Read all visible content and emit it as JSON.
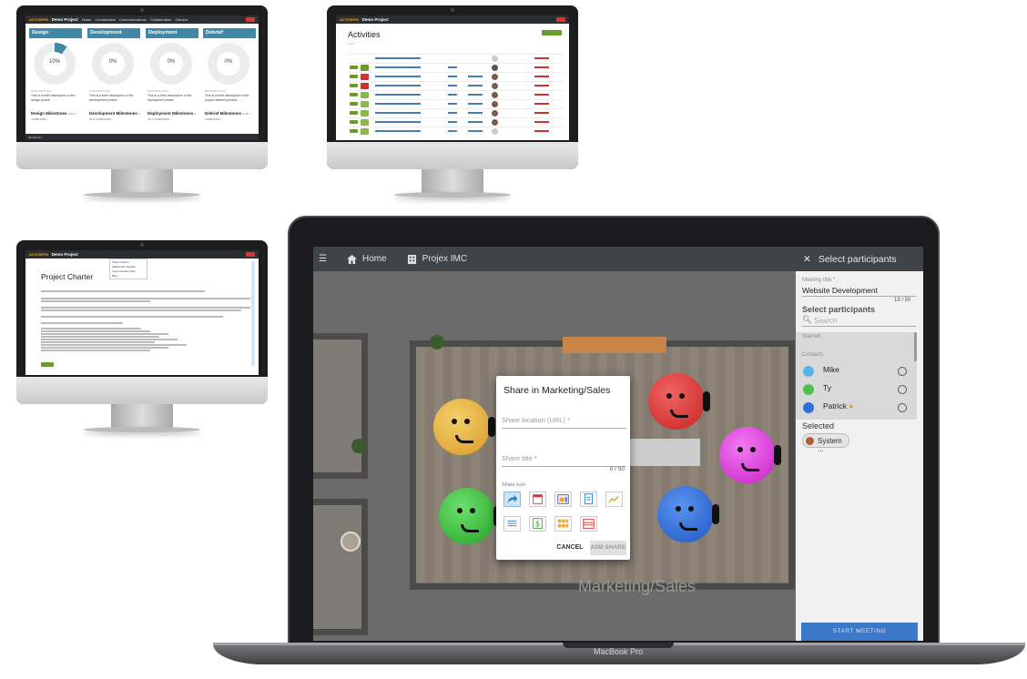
{
  "screen_a": {
    "logo": "ACTIVEPM",
    "project": "Demo Project",
    "nav": [
      "Home",
      "Coordination",
      "Communications",
      "Collaboration",
      "Owners"
    ],
    "phases": [
      {
        "title": "Design",
        "percent": "10%",
        "desc_label": "DESCRIPTION",
        "desc": "This is a brief description of the design phase.",
        "milestones": "Design Milestones",
        "count": "0 OF 4 COMPLETED"
      },
      {
        "title": "Development",
        "percent": "0%",
        "desc_label": "DESCRIPTION",
        "desc": "This is a brief description of the development phase.",
        "milestones": "Development Milestones",
        "count": "0 OF 2 COMPLETED"
      },
      {
        "title": "Deployment",
        "percent": "0%",
        "desc_label": "DESCRIPTION",
        "desc": "This is a brief description of the deployment phase.",
        "milestones": "Deployment Milestones",
        "count": "0 OF 2 COMPLETED"
      },
      {
        "title": "Debrief",
        "percent": "0%",
        "desc_label": "DESCRIPTION",
        "desc": "This is a brief description of the project debrief process.",
        "milestones": "Debrief Milestones",
        "count": "0 OF 1 COMPLETED"
      }
    ],
    "progress_fraction": [
      0.1,
      0,
      0,
      0
    ],
    "footer": "WordPress"
  },
  "screen_b": {
    "logo": "ACTIVEPM",
    "project": "Demo Project",
    "title": "Activities"
  },
  "screen_c": {
    "logo": "ACTIVEPM",
    "project": "Demo Project",
    "title": "Project Charter",
    "menu": [
      "Project Charter",
      "Stakeholder Register",
      "Communication Plan",
      "Blog"
    ]
  },
  "laptop": {
    "brand": "MacBook Pro",
    "nav": {
      "home": "Home",
      "building": "Projex IMC"
    },
    "room_label": "Marketing/Sales",
    "dialog": {
      "title": "Share in Marketing/Sales",
      "url_label": "Share location (URL) *",
      "title_label": "Share title *",
      "counter": "0 / 50",
      "icon_label": "Share icon",
      "cancel": "CANCEL",
      "add": "ADD SHARE",
      "icons": [
        "share-arrow",
        "calendar",
        "chart",
        "document",
        "line-chart",
        "list",
        "dollar",
        "grid",
        "table"
      ]
    },
    "panel": {
      "title": "Select participants",
      "meeting_label": "Meeting title *",
      "meeting_value": "Website Development",
      "meeting_count": "19 / 50",
      "select_heading": "Select participants",
      "search_placeholder": "Search",
      "starred_label": "Starred",
      "contacts_label": "Contacts",
      "contacts": [
        "Mike",
        "Ty",
        "Patrick"
      ],
      "selected_label": "Selected",
      "selected_chip": "System ...",
      "start": "START MEETING"
    },
    "colors": {
      "yellow": "#e8b43c",
      "red": "#e23b3b",
      "magenta": "#e53be5",
      "green": "#3fc43f",
      "blue": "#2f6fdd"
    }
  }
}
